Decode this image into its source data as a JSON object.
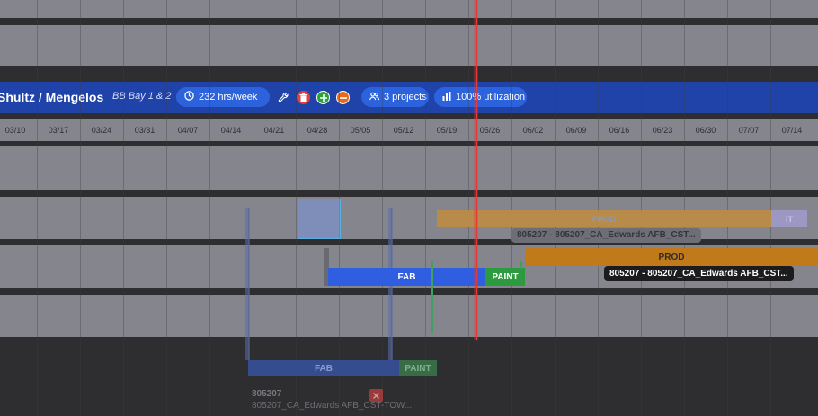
{
  "header": {
    "name": "Shultz / Mengelos",
    "location": "BB Bay 1 & 2",
    "hours": "232 hrs/week",
    "projects": "3 projects",
    "utilization": "100% utilization"
  },
  "timeline": {
    "dates": [
      "03/10",
      "03/17",
      "03/24",
      "03/31",
      "04/07",
      "04/14",
      "04/21",
      "04/28",
      "05/05",
      "05/12",
      "05/19",
      "05/26",
      "06/02",
      "06/09",
      "06/16",
      "06/23",
      "06/30",
      "07/07",
      "07/14"
    ]
  },
  "bars": {
    "ghost_prod": "PROD",
    "ghost_it": "IT",
    "ghost_tooltip": "805207 - 805207_CA_Edwards AFB_CST...",
    "prod": "PROD",
    "fab": "FAB",
    "paint": "PAINT",
    "tooltip": "805207 - 805207_CA_Edwards AFB_CST..."
  },
  "drag_preview": {
    "fab": "FAB",
    "paint": "PAINT",
    "project_number": "805207",
    "project_name": "805207_CA_Edwards AFB_CST-TOW..."
  },
  "colors": {
    "header_bg": "#1f43a8",
    "fab": "#2f5fe0",
    "paint": "#2e9a3f",
    "prod": "#c07a1a",
    "today_line": "#e03a3a",
    "delete": "#e34040",
    "add": "#2e9f3e",
    "remove": "#e56a1f"
  }
}
